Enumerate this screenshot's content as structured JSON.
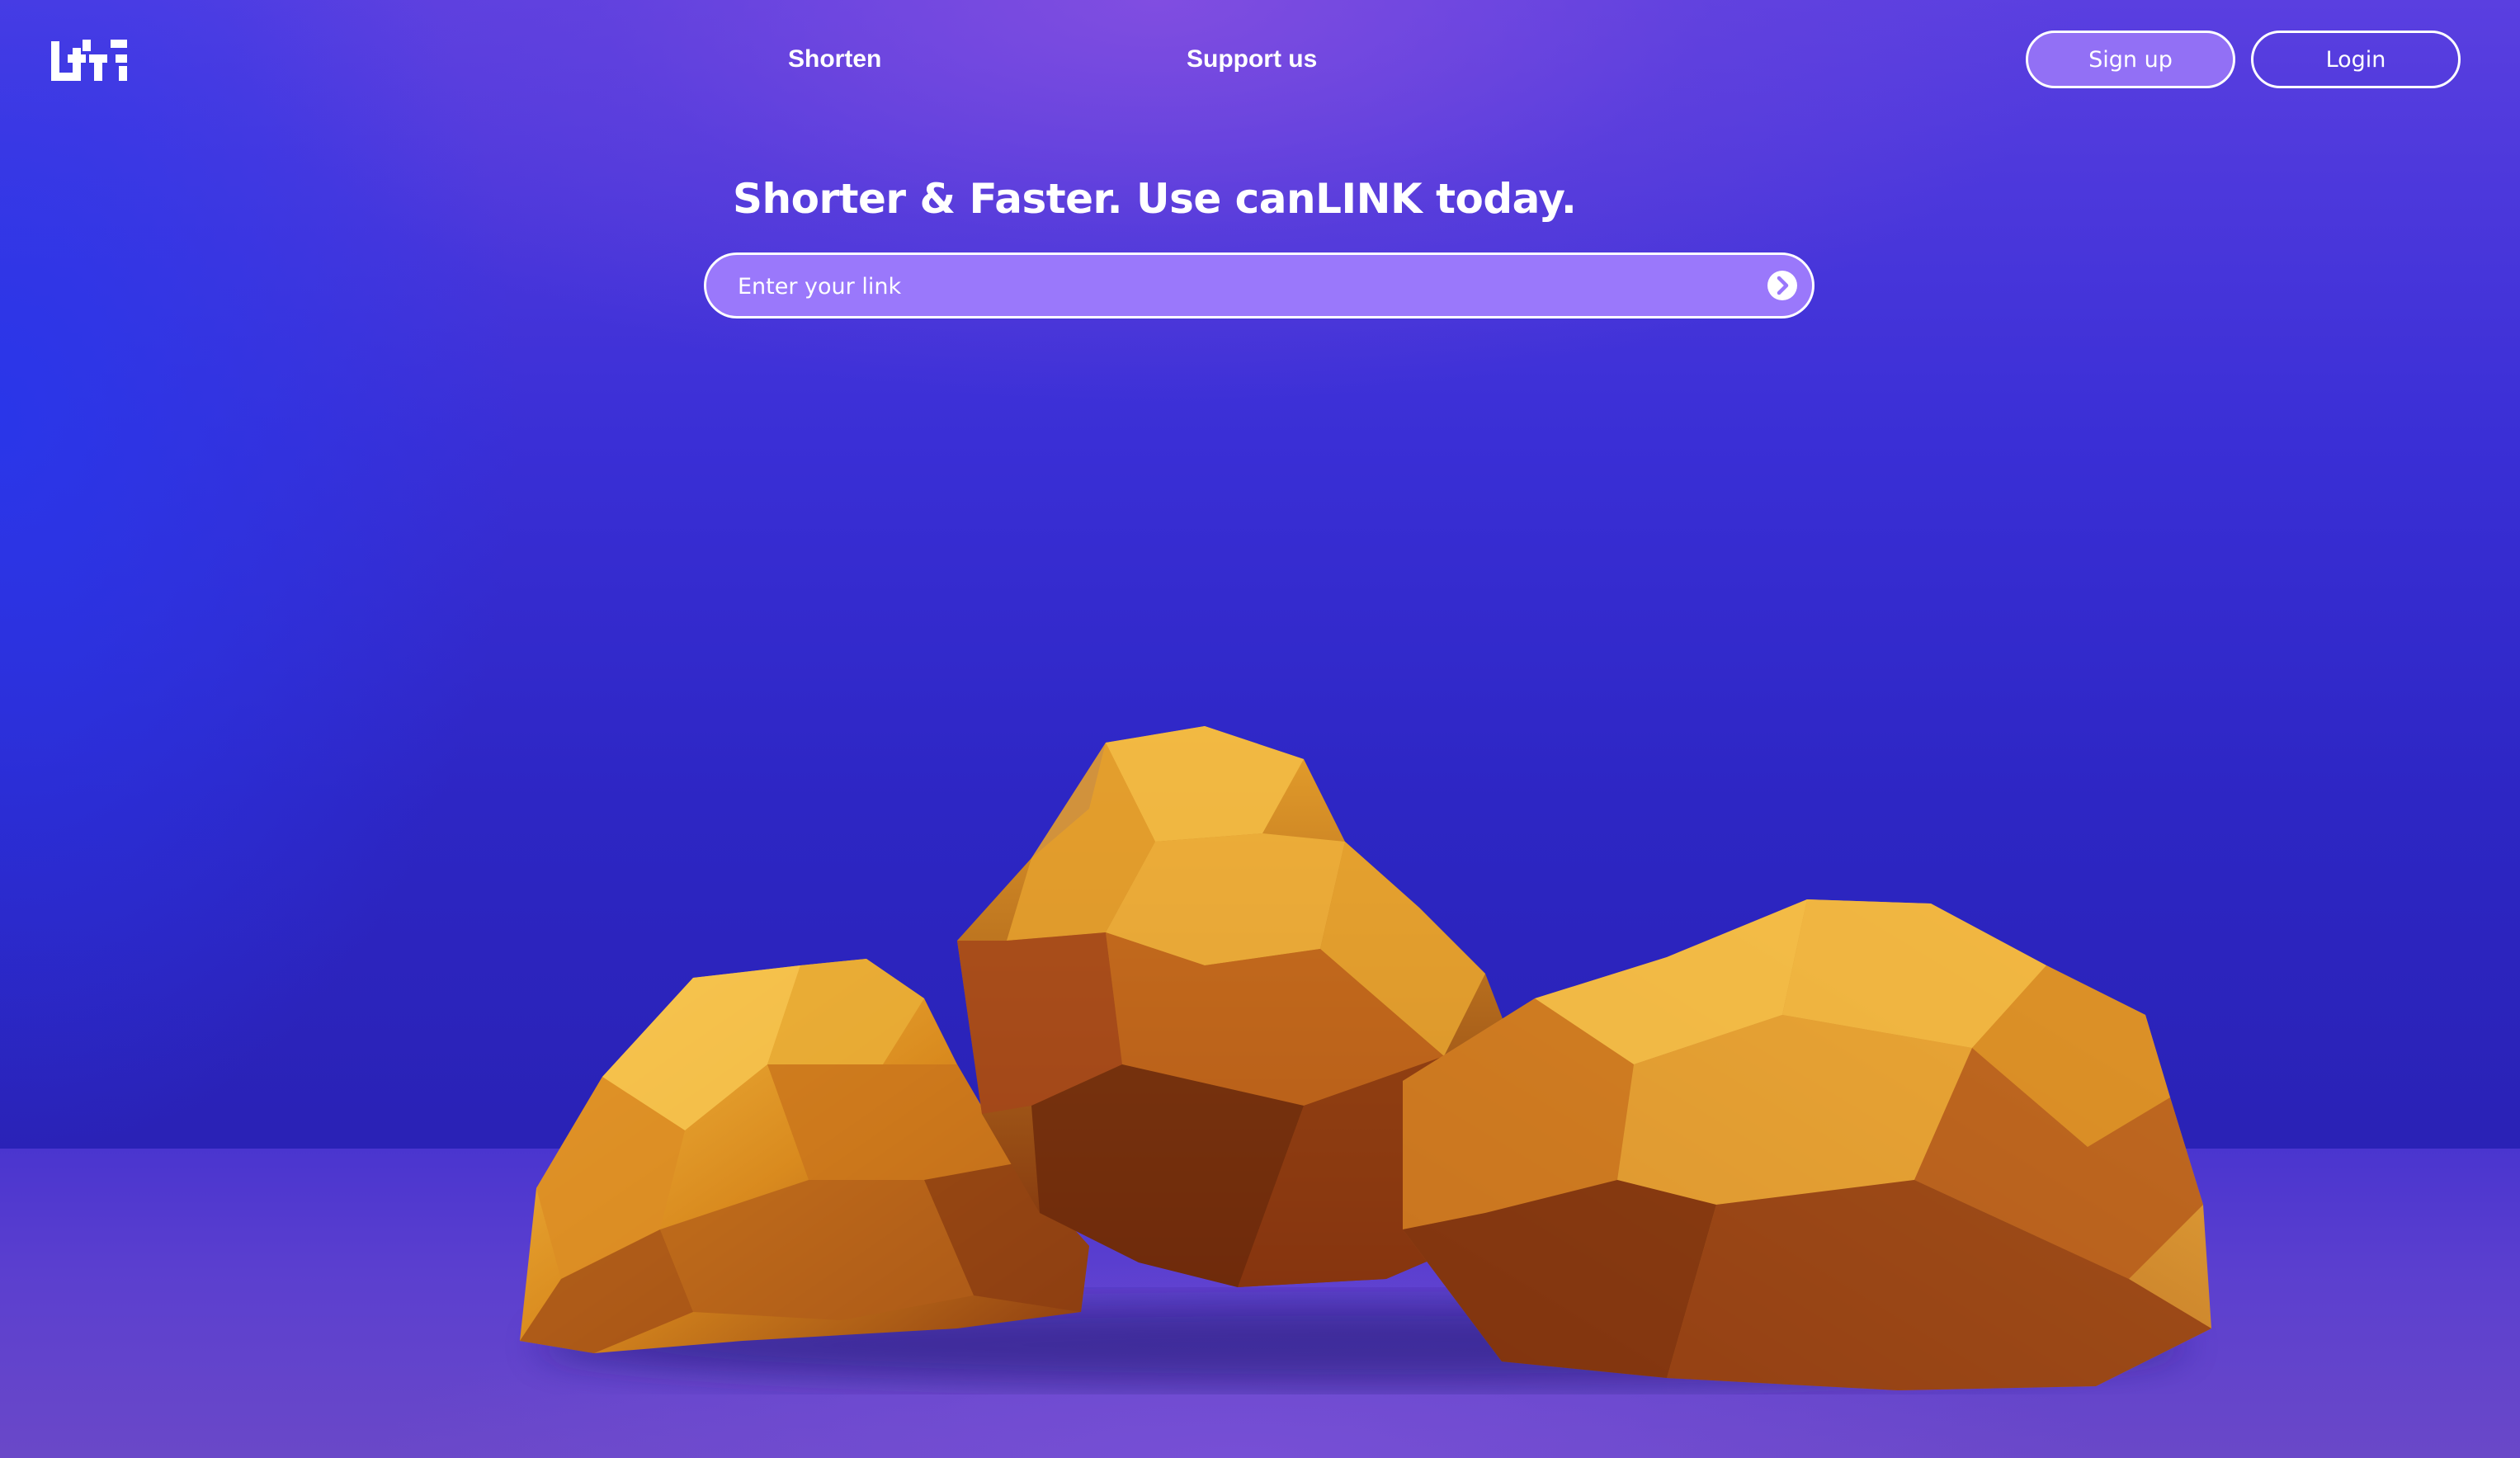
{
  "app": {
    "brand_name": "canLINK"
  },
  "nav": {
    "shorten_label": "Shorten",
    "support_label": "Support us"
  },
  "auth": {
    "signup_label": "Sign up",
    "login_label": "Login"
  },
  "hero": {
    "headline": "Shorter & Faster. Use canLINK today.",
    "input_placeholder": "Enter your link",
    "input_value": ""
  },
  "icons": {
    "logo": "lh-logo-icon",
    "submit": "chevron-right-circle-icon"
  },
  "colors": {
    "background_blue": "#2d26c4",
    "background_purple": "#5a3fe0",
    "input_fill": "#9a78fb",
    "signup_fill": "#9270f5",
    "text": "#ffffff",
    "gold": "#e0a22a"
  }
}
